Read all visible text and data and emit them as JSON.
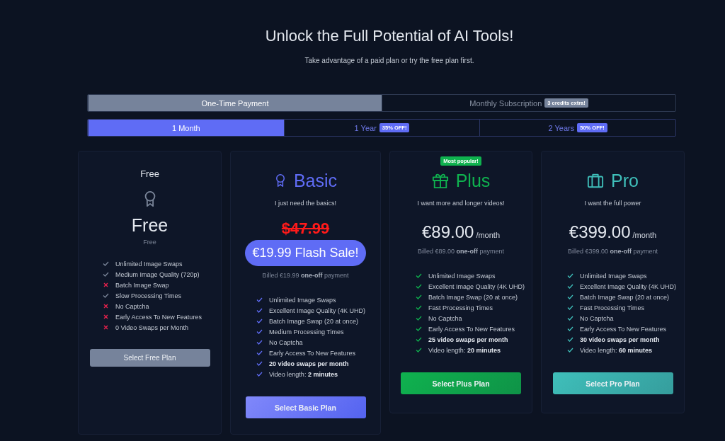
{
  "header": {
    "title": "Unlock the Full Potential of AI Tools!",
    "subtitle": "Take advantage of a paid plan or try the free plan first."
  },
  "payment_tabs": [
    {
      "label": "One-Time Payment",
      "selected": true
    },
    {
      "label": "Monthly Subscription",
      "badge": "3 credits extra!",
      "selected": false
    }
  ],
  "period_tabs": [
    {
      "label": "1 Month",
      "selected": true
    },
    {
      "label": "1 Year",
      "badge": "35% OFF!",
      "selected": false
    },
    {
      "label": "2 Years",
      "badge": "50% OFF!",
      "selected": false
    }
  ],
  "plans": [
    {
      "kind": "free",
      "name": "Free",
      "color": "#7a8599",
      "price": "Free",
      "price_note": "Free",
      "features": [
        {
          "text": "Unlimited Image Swaps",
          "included": true
        },
        {
          "text": "Medium Image Quality (720p)",
          "included": true
        },
        {
          "text": "Batch Image Swap",
          "included": false
        },
        {
          "text": "Slow Processing Times",
          "included": true
        },
        {
          "text": "No Captcha",
          "included": false
        },
        {
          "text": "Early Access To New Features",
          "included": false
        },
        {
          "text": "0 Video Swaps per Month",
          "included": false
        }
      ],
      "button": "Select Free Plan"
    },
    {
      "kind": "sale",
      "name": "Basic",
      "color": "#5f6cf5",
      "tagline": "I just need the basics!",
      "old_price": "$47.99",
      "sale_price": "€19.99 Flash Sale!",
      "billing": "Billed €19.99 **one-off** payment",
      "features": [
        {
          "text": "Unlimited Image Swaps",
          "included": true
        },
        {
          "text": "Excellent Image Quality (4K UHD)",
          "included": true
        },
        {
          "text": "Batch Image Swap (20 at once)",
          "included": true
        },
        {
          "text": "Medium Processing Times",
          "included": true
        },
        {
          "text": "No Captcha",
          "included": true
        },
        {
          "text": "Early Access To New Features",
          "included": true
        },
        {
          "text": "**20 video swaps per month**",
          "included": true
        },
        {
          "text": "Video length: **2 minutes**",
          "included": true
        }
      ],
      "button": "Select Basic Plan"
    },
    {
      "kind": "paid",
      "badge": "Most popular!",
      "name": "Plus",
      "color": "#0fb24f",
      "tagline": "I want more and longer videos!",
      "price": "€89.00",
      "period": "/month",
      "billing": "Billed €89.00 **one-off** payment",
      "features": [
        {
          "text": "Unlimited Image Swaps",
          "included": true
        },
        {
          "text": "Excellent Image Quality (4K UHD)",
          "included": true
        },
        {
          "text": "Batch Image Swap (20 at once)",
          "included": true
        },
        {
          "text": "Fast Processing Times",
          "included": true
        },
        {
          "text": "No Captcha",
          "included": true
        },
        {
          "text": "Early Access To New Features",
          "included": true
        },
        {
          "text": "**25 video swaps per month**",
          "included": true
        },
        {
          "text": "Video length: **20 minutes**",
          "included": true
        }
      ],
      "button": "Select Plus Plan"
    },
    {
      "kind": "paid",
      "name": "Pro",
      "color": "#3fbfba",
      "tagline": "I want the full power",
      "price": "€399.00",
      "period": "/month",
      "billing": "Billed €399.00 **one-off** payment",
      "features": [
        {
          "text": "Unlimited Image Swaps",
          "included": true
        },
        {
          "text": "Excellent Image Quality (4K UHD)",
          "included": true
        },
        {
          "text": "Batch Image Swap (20 at once)",
          "included": true
        },
        {
          "text": "Fast Processing Times",
          "included": true
        },
        {
          "text": "No Captcha",
          "included": true
        },
        {
          "text": "Early Access To New Features",
          "included": true
        },
        {
          "text": "**30 video swaps per month**",
          "included": true
        },
        {
          "text": "Video length: **60 minutes**",
          "included": true
        }
      ],
      "button": "Select Pro Plan"
    }
  ]
}
